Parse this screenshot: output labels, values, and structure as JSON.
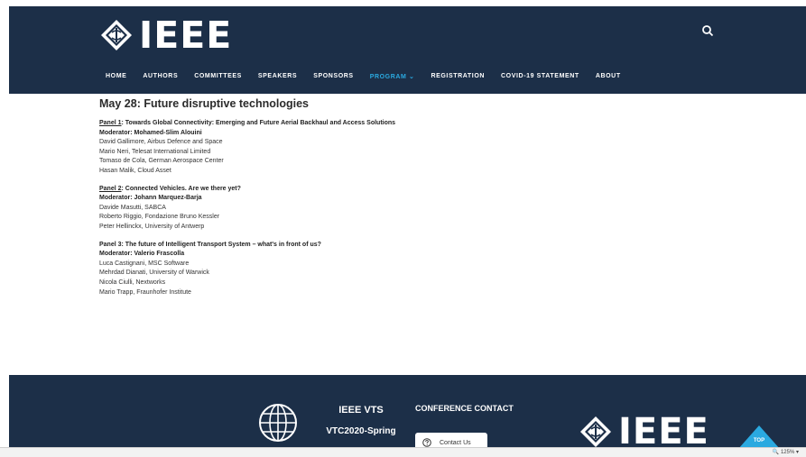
{
  "header": {
    "logo_text": "IEEE",
    "nav": [
      {
        "label": "HOME"
      },
      {
        "label": "AUTHORS"
      },
      {
        "label": "COMMITTEES"
      },
      {
        "label": "SPEAKERS"
      },
      {
        "label": "SPONSORS"
      },
      {
        "label": "PROGRAM ⌄",
        "active": true
      },
      {
        "label": "REGISTRATION"
      },
      {
        "label": "COVID-19 STATEMENT"
      },
      {
        "label": "ABOUT"
      }
    ]
  },
  "content": {
    "title": "May 28: Future disruptive technologies",
    "panels": [
      {
        "label_link": "Panel 1",
        "label_rest": ": Towards Global Connectivity: Emerging and Future Aerial Backhaul and Access Solutions",
        "moderator": "Moderator: Mohamed-Slim Alouini",
        "members": [
          "David Gallimore, Airbus Defence and Space",
          "Mario Neri, Telesat International Limited",
          "Tomaso de Cola, German Aerospace Center",
          "Hasan Malik, Cloud Asset"
        ]
      },
      {
        "label_link": "Panel 2",
        "label_rest": ": Connected Vehicles. Are we there yet?",
        "moderator": "Moderator: Johann Marquez-Barja",
        "members": [
          "Davide Masutti, SABCA",
          "Roberto Riggio, Fondazione Bruno Kessler",
          "Peter Hellinckx, University of Antwerp"
        ]
      },
      {
        "label_link": "",
        "label_rest": "Panel 3: The future of Intelligent Transport System – what's in front of us?",
        "moderator": "Moderator: Valerio Frascolla",
        "members": [
          "Luca Castignani, MSC Software",
          "Mehrdad Dianati, University of Warwick",
          "Nicola Ciulli, Nextworks",
          "Mario Trapp, Fraunhofer Institute"
        ]
      }
    ]
  },
  "footer": {
    "vts_title": "IEEE VTS",
    "vts_subtitle": "VTC2020-Spring",
    "contact_heading": "CONFERENCE CONTACT",
    "contact_button": "Contact Us",
    "logo_text": "IEEE",
    "top_label": "TOP"
  },
  "status": {
    "zoom": "125%"
  },
  "colors": {
    "navy": "#1c2f48",
    "accent": "#2aa9e0"
  }
}
